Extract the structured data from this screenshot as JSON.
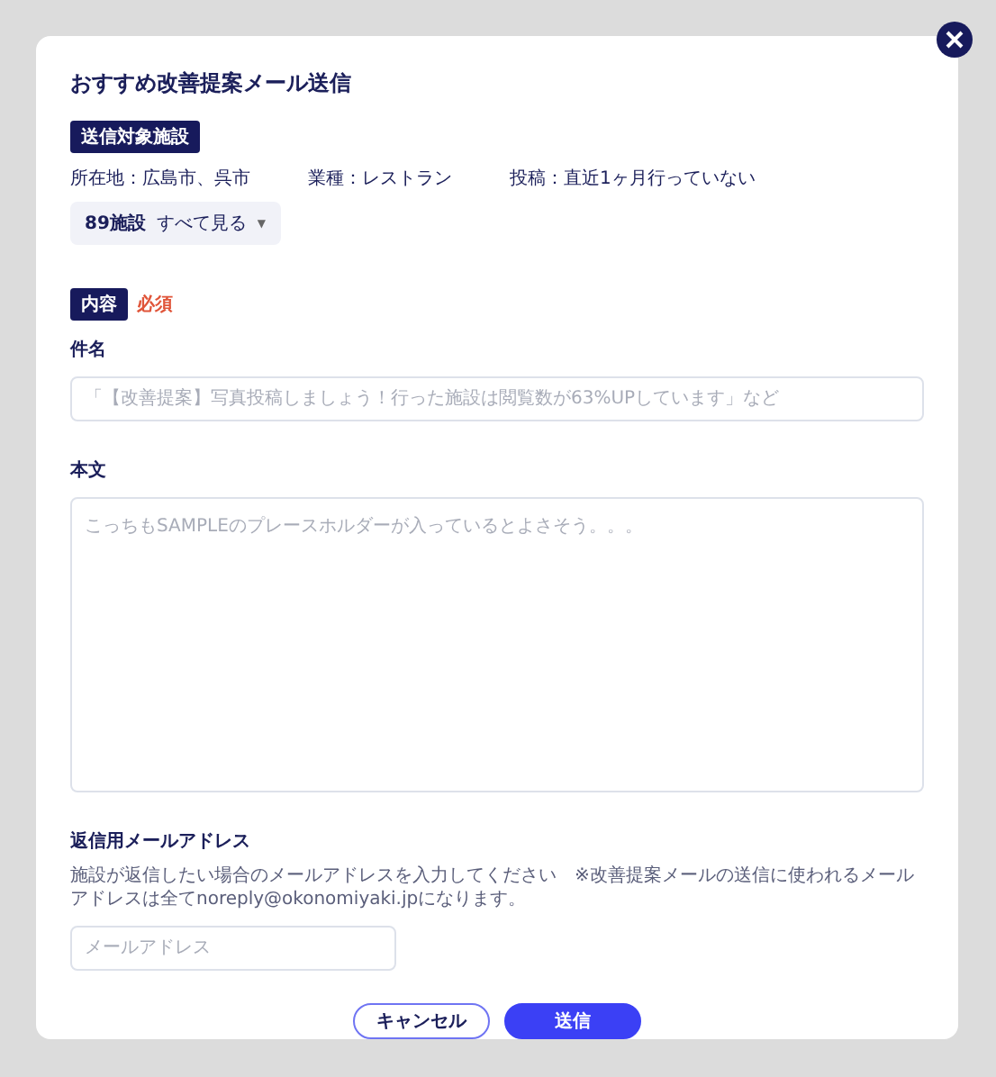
{
  "dialog": {
    "title": "おすすめ改善提案メール送信"
  },
  "target": {
    "heading": "送信対象施設",
    "conditions": [
      "所在地：広島市、呉市",
      "業種：レストラン",
      "投稿：直近1ヶ月行っていない"
    ],
    "count": "89施設",
    "see_all": "すべて見る",
    "see_all_icon": "▼"
  },
  "content": {
    "heading": "内容",
    "required": "必須"
  },
  "subject": {
    "label": "件名",
    "placeholder": "「【改善提案】写真投稿しましょう！行った施設は閲覧数が63%UPしています」など"
  },
  "body": {
    "label": "本文",
    "placeholder": "こっちもSAMPLEのプレースホルダーが入っているとよさそう。。。"
  },
  "reply": {
    "label": "返信用メールアドレス",
    "hint": "施設が返信したい場合のメールアドレスを入力してください　※改善提案メールの送信に使われるメールアドレスは全てnoreply@okonomiyaki.jpになります。",
    "placeholder": "メールアドレス"
  },
  "buttons": [
    {
      "label": "キャンセル",
      "kind": "secondary"
    },
    {
      "label": "送信",
      "kind": "primary"
    }
  ]
}
